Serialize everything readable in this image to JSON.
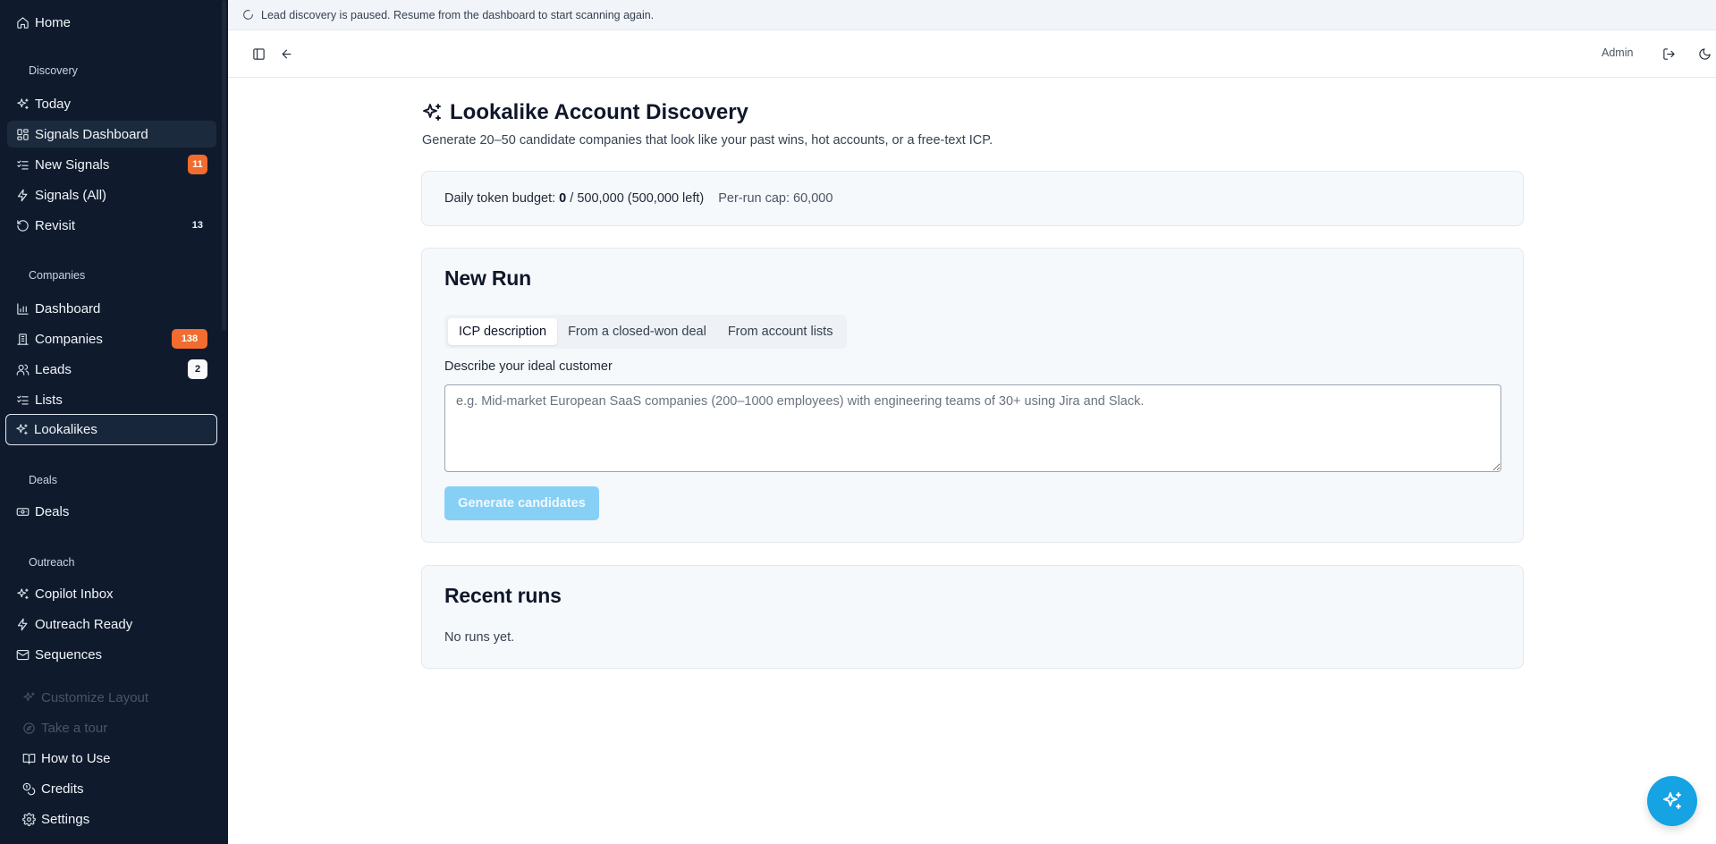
{
  "sidebar": {
    "home": {
      "label": "Home",
      "icon": "home-icon"
    },
    "groups": {
      "discovery": "Discovery",
      "companies": "Companies",
      "deals": "Deals",
      "outreach": "Outreach"
    },
    "items": {
      "today": {
        "label": "Today",
        "icon": "sparkles-icon"
      },
      "signals_dashboard": {
        "label": "Signals Dashboard",
        "icon": "layout-grid-icon"
      },
      "new_signals": {
        "label": "New Signals",
        "icon": "list-checks-icon",
        "badge": "11"
      },
      "signals_all": {
        "label": "Signals (All)",
        "icon": "zap-icon"
      },
      "revisit": {
        "label": "Revisit",
        "icon": "rotate-ccw-icon",
        "badge": "13"
      },
      "dashboard": {
        "label": "Dashboard",
        "icon": "bar-chart-icon"
      },
      "companies": {
        "label": "Companies",
        "icon": "building-icon",
        "badge": "138"
      },
      "leads": {
        "label": "Leads",
        "icon": "users-icon",
        "badge": "2"
      },
      "lists": {
        "label": "Lists",
        "icon": "list-checks-icon"
      },
      "lookalikes": {
        "label": "Lookalikes",
        "icon": "sparkles-icon"
      },
      "deals": {
        "label": "Deals",
        "icon": "banknote-icon"
      },
      "copilot_inbox": {
        "label": "Copilot Inbox",
        "icon": "sparkles-icon"
      },
      "outreach_ready": {
        "label": "Outreach Ready",
        "icon": "zap-icon"
      },
      "sequences": {
        "label": "Sequences",
        "icon": "mail-icon"
      }
    },
    "footer": {
      "customize": {
        "label": "Customize Layout",
        "icon": "sparkles-icon"
      },
      "tour": {
        "label": "Take a tour",
        "icon": "compass-icon"
      },
      "how_to": {
        "label": "How to Use",
        "icon": "book-open-icon"
      },
      "credits": {
        "label": "Credits",
        "icon": "coins-icon"
      },
      "settings": {
        "label": "Settings",
        "icon": "gear-icon"
      }
    }
  },
  "banner": {
    "text": "Lead discovery is paused. Resume from the dashboard to start scanning again."
  },
  "header": {
    "user": "Admin"
  },
  "main": {
    "title": "Lookalike Account Discovery",
    "subtitle": "Generate 20–50 candidate companies that look like your past wins, hot accounts, or a free-text ICP.",
    "budget": {
      "label": "Daily token budget:",
      "used": "0",
      "rest": "/ 500,000 (500,000 left)",
      "cap": "Per-run cap: 60,000"
    },
    "new_run": {
      "title": "New Run",
      "tabs": [
        "ICP description",
        "From a closed-won deal",
        "From account lists"
      ],
      "active_tab": 0,
      "field_label": "Describe your ideal customer",
      "placeholder": "e.g. Mid-market European SaaS companies (200–1000 employees) with engineering teams of 30+ using Jira and Slack.",
      "value": "",
      "button": "Generate candidates"
    },
    "recent": {
      "title": "Recent runs",
      "empty": "No runs yet."
    }
  },
  "colors": {
    "sidebar_bg": "#0f1b2d",
    "badge_orange": "#f26b2f",
    "accent": "#15a3e4",
    "button_disabled": "#87d0f5"
  }
}
